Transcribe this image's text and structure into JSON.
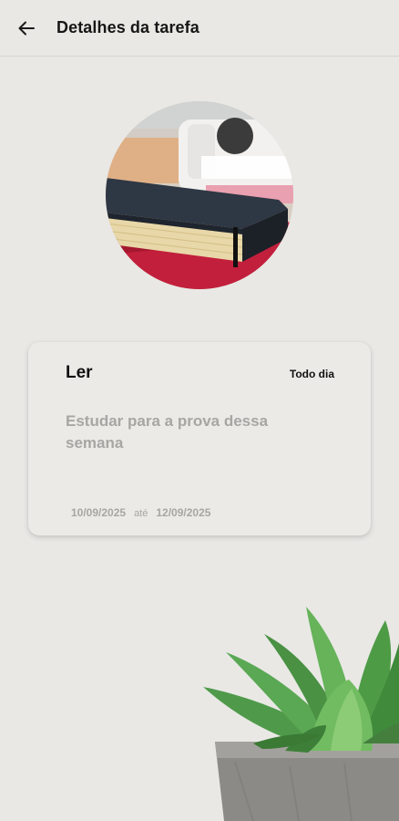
{
  "header": {
    "title": "Detalhes da tarefa",
    "back_icon": "arrow-left-icon"
  },
  "task": {
    "image_subject": "notebook-photo",
    "name": "Ler",
    "frequency": "Todo dia",
    "description": "Estudar para a prova dessa semana",
    "start_date": "10/09/2025",
    "date_separator": "até",
    "end_date": "12/09/2025"
  },
  "decoration": {
    "plant": "succulent-plant-image"
  },
  "colors": {
    "background": "#e9e8e5",
    "text_primary": "#111111",
    "text_muted": "#a7a6a3"
  }
}
